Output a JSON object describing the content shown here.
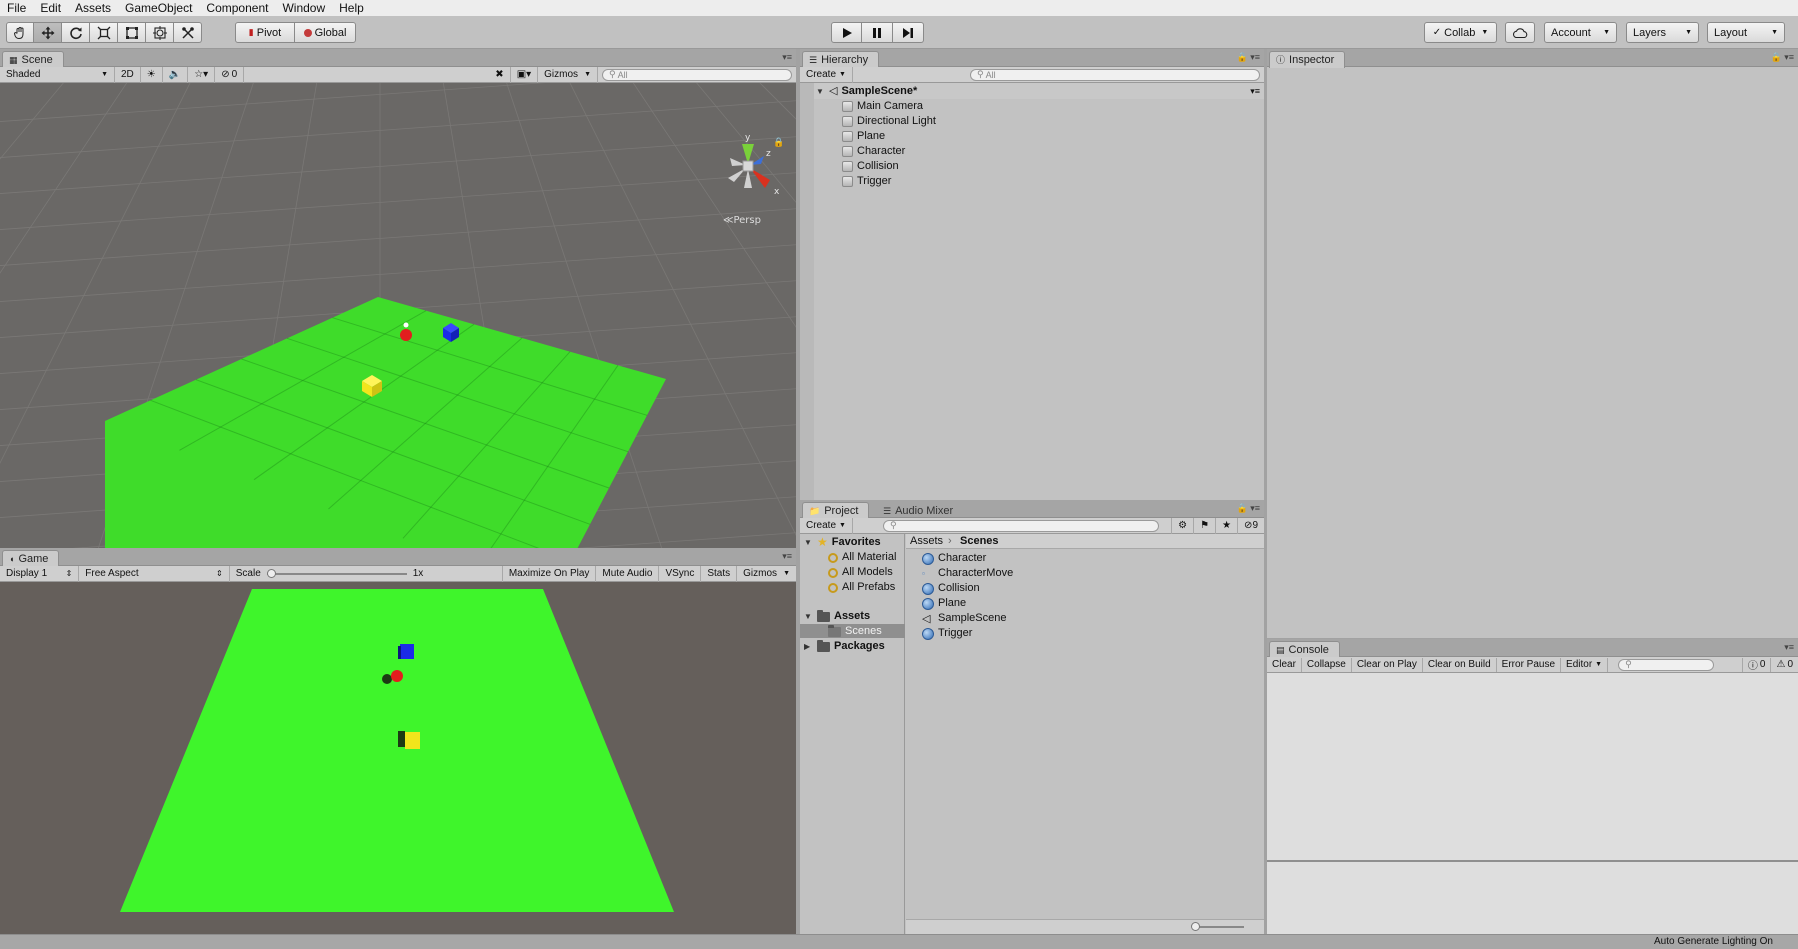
{
  "menu": [
    "File",
    "Edit",
    "Assets",
    "GameObject",
    "Component",
    "Window",
    "Help"
  ],
  "toolbar": {
    "tools": [
      "hand-tool-icon",
      "move-tool-icon",
      "rotate-tool-icon",
      "scale-tool-icon",
      "rect-tool-icon",
      "transform-tool-icon",
      "custom-tool-icon"
    ],
    "pivot": "Pivot",
    "global": "Global",
    "collab": "Collab",
    "account": "Account",
    "layers": "Layers",
    "layout": "Layout"
  },
  "scene": {
    "tab": "Scene",
    "shading": "Shaded",
    "mode_2d": "2D",
    "fx_count": "0",
    "gizmos": "Gizmos",
    "search_placeholder": "All",
    "gizmo_y": "y",
    "gizmo_x": "x",
    "gizmo_z": "z",
    "persp": "Persp"
  },
  "game": {
    "tab": "Game",
    "display": "Display 1",
    "aspect": "Free Aspect",
    "scale_label": "Scale",
    "scale_value": "1x",
    "maximize": "Maximize On Play",
    "mute": "Mute Audio",
    "vsync": "VSync",
    "stats": "Stats",
    "gizmos": "Gizmos"
  },
  "hierarchy": {
    "tab": "Hierarchy",
    "create": "Create",
    "search_placeholder": "All",
    "scene_name": "SampleScene*",
    "items": [
      "Main Camera",
      "Directional Light",
      "Plane",
      "Character",
      "Collision",
      "Trigger"
    ]
  },
  "inspector": {
    "tab": "Inspector"
  },
  "project": {
    "tab": "Project",
    "tab2": "Audio Mixer",
    "create": "Create",
    "hidden_count": "9",
    "favorites": "Favorites",
    "favorite_items": [
      "All Material",
      "All Models",
      "All Prefabs"
    ],
    "assets": "Assets",
    "scenes": "Scenes",
    "packages": "Packages",
    "breadcrumb": [
      "Assets",
      "Scenes"
    ],
    "files": [
      {
        "name": "Character",
        "icon": "script"
      },
      {
        "name": "CharacterMove",
        "icon": "file"
      },
      {
        "name": "Collision",
        "icon": "script"
      },
      {
        "name": "Plane",
        "icon": "script"
      },
      {
        "name": "SampleScene",
        "icon": "scene"
      },
      {
        "name": "Trigger",
        "icon": "script"
      }
    ]
  },
  "console": {
    "tab": "Console",
    "buttons": [
      "Clear",
      "Collapse",
      "Clear on Play",
      "Clear on Build",
      "Error Pause",
      "Editor"
    ],
    "errors": "0",
    "warnings": "0"
  },
  "status": {
    "text": "Auto Generate Lighting On"
  },
  "colors": {
    "plane": "#3fdc2a",
    "game_plane": "#3ff52b",
    "scene_bg": "#6a6866",
    "game_bg": "#655f5b",
    "blue": "#1b2be8",
    "red": "#e21e1e",
    "yellow": "#f1e51c"
  }
}
